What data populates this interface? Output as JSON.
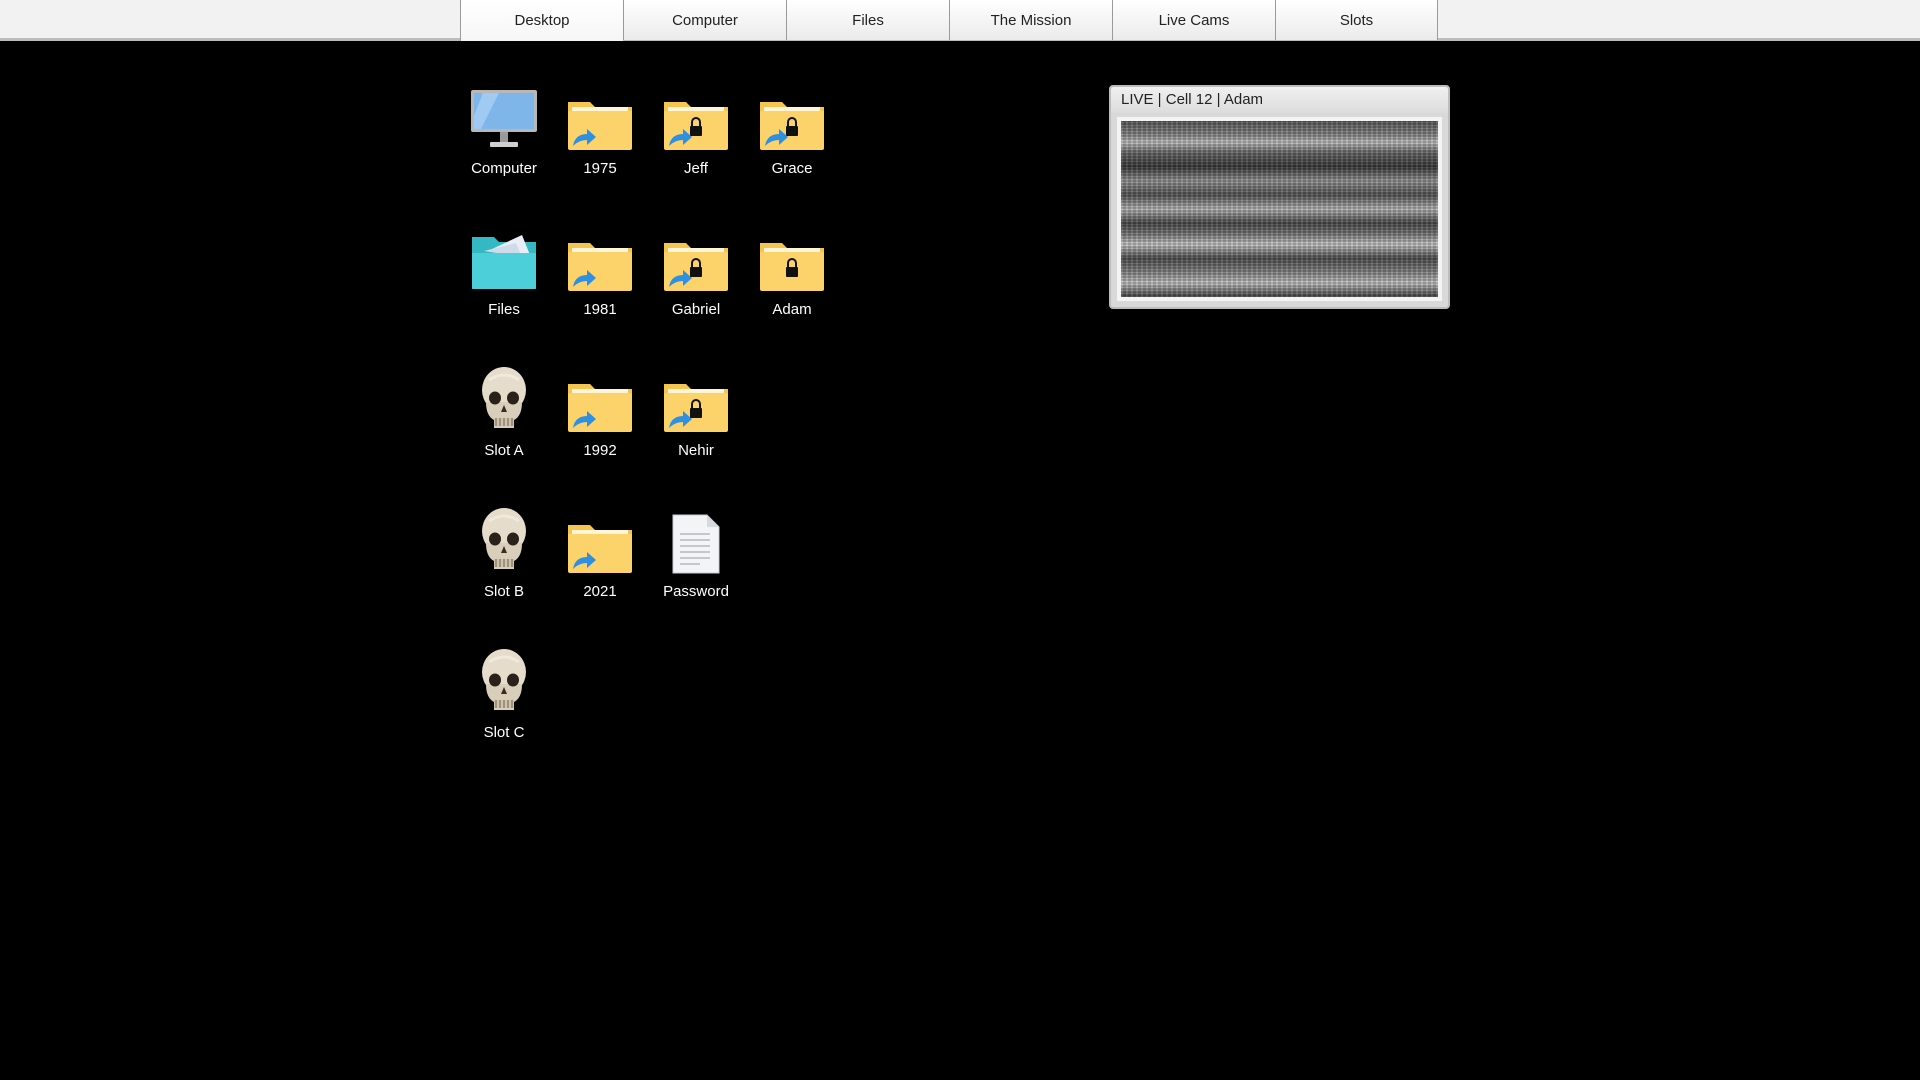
{
  "nav": {
    "tabs": [
      {
        "label": "Desktop",
        "active": true
      },
      {
        "label": "Computer"
      },
      {
        "label": "Files"
      },
      {
        "label": "The Mission"
      },
      {
        "label": "Live Cams"
      },
      {
        "label": "Slots"
      }
    ]
  },
  "desktop": {
    "icons": [
      {
        "label": "Computer",
        "icon": "monitor-icon"
      },
      {
        "label": "1975",
        "icon": "folder-shortcut-icon"
      },
      {
        "label": "Jeff",
        "icon": "locked-folder-shortcut-icon"
      },
      {
        "label": "Grace",
        "icon": "locked-folder-shortcut-icon"
      },
      {
        "label": "Files",
        "icon": "teal-folder-icon"
      },
      {
        "label": "1981",
        "icon": "folder-shortcut-icon"
      },
      {
        "label": "Gabriel",
        "icon": "locked-folder-shortcut-icon"
      },
      {
        "label": "Adam",
        "icon": "locked-folder-icon"
      },
      {
        "label": "Slot A",
        "icon": "skull-icon"
      },
      {
        "label": "1992",
        "icon": "folder-shortcut-icon"
      },
      {
        "label": "Nehir",
        "icon": "locked-folder-shortcut-icon"
      },
      {
        "label": "Slot B",
        "icon": "skull-icon"
      },
      {
        "label": "2021",
        "icon": "folder-shortcut-icon"
      },
      {
        "label": "Password",
        "icon": "text-document-icon"
      },
      {
        "label": "Slot C",
        "icon": "skull-icon"
      }
    ]
  },
  "livecam": {
    "title": "LIVE | Cell 12 | Adam"
  },
  "colors": {
    "background": "#000000",
    "folder": "#fcd36b",
    "folder_tab": "#f5c451",
    "shortcut_arrow": "#2f8fe0",
    "teal_folder": "#4dcfd9"
  }
}
